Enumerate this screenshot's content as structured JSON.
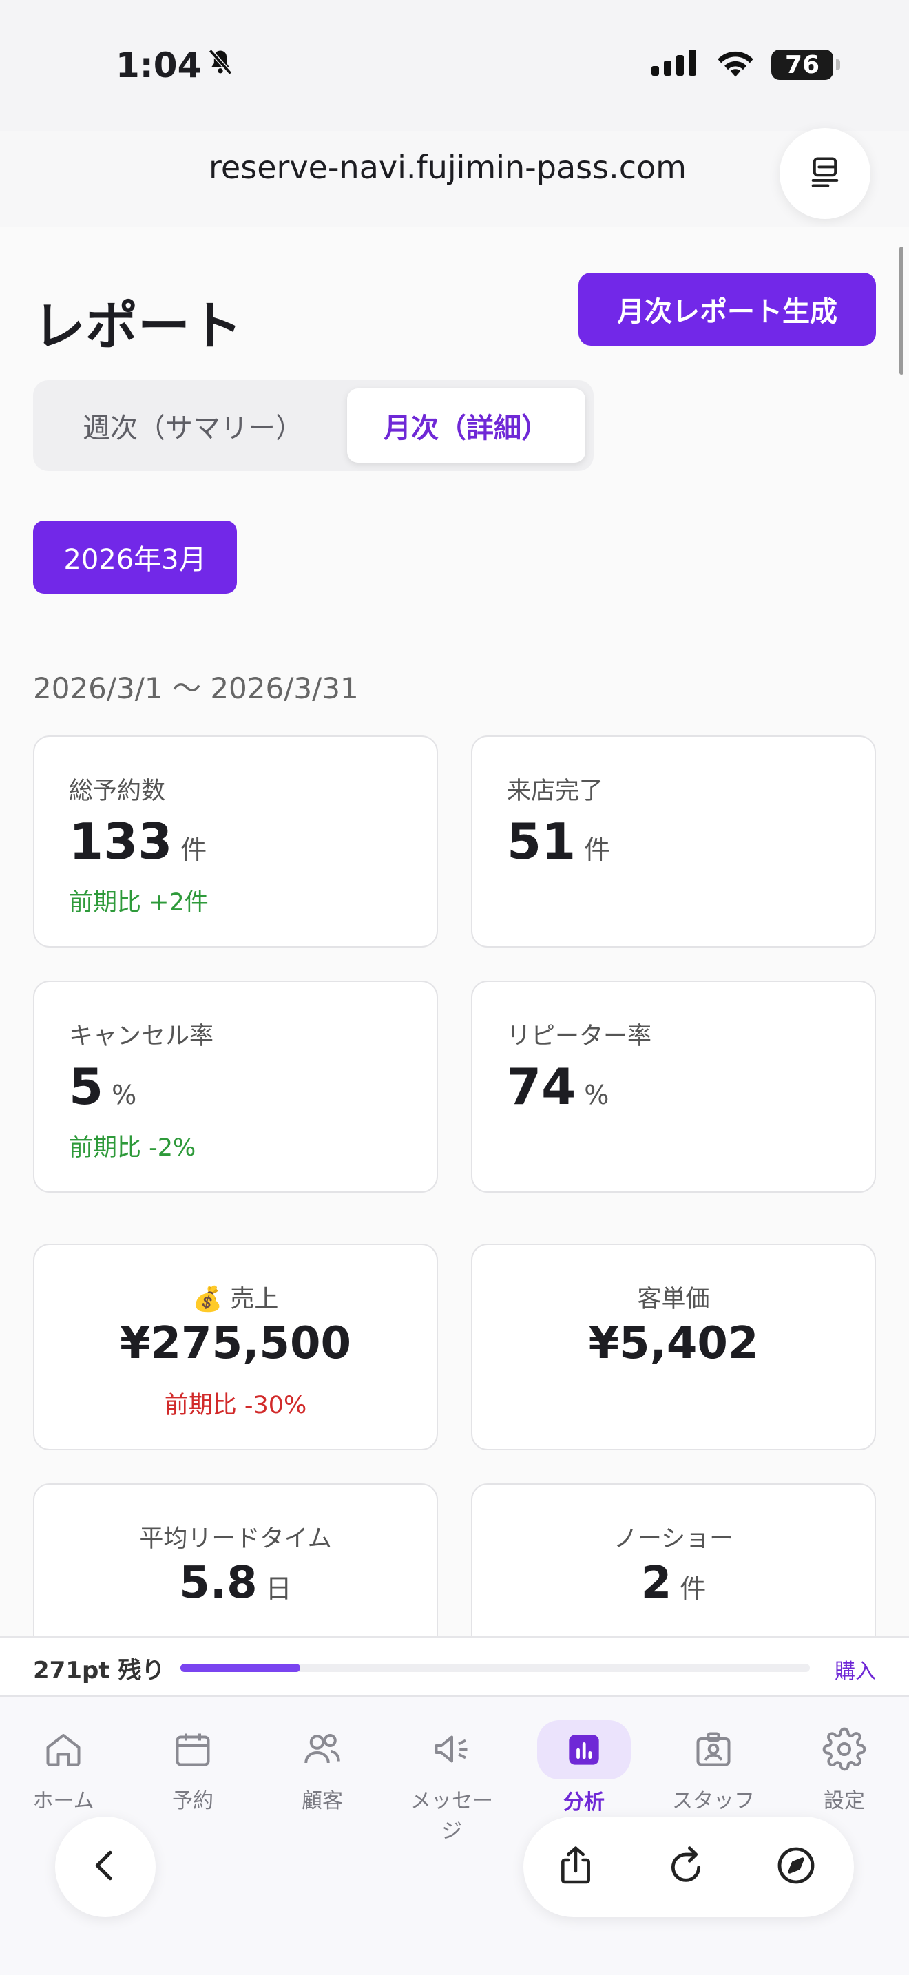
{
  "status": {
    "time": "1:04",
    "battery": "76"
  },
  "browser": {
    "url": "reserve-navi.fujimin-pass.com"
  },
  "page": {
    "title": "レポート",
    "generate_button": "月次レポート生成"
  },
  "segment": {
    "weekly": "週次（サマリー）",
    "monthly": "月次（詳細）",
    "selected": "月次（詳細）"
  },
  "period": {
    "month": "2026年3月",
    "range": "2026/3/1 〜 2026/3/31"
  },
  "stats": {
    "total_reservations": {
      "label": "総予約数",
      "value": "133",
      "unit": "件",
      "delta": "前期比 +2件"
    },
    "visits_completed": {
      "label": "来店完了",
      "value": "51",
      "unit": "件"
    },
    "cancel_rate": {
      "label": "キャンセル率",
      "value": "5",
      "unit": "%",
      "delta": "前期比 -2%"
    },
    "repeater_rate": {
      "label": "リピーター率",
      "value": "74",
      "unit": "%"
    },
    "sales": {
      "icon": "money-bag-icon",
      "label": "売上",
      "value": "¥275,500",
      "delta": "前期比 -30%"
    },
    "avg_spend": {
      "label": "客単価",
      "value": "¥5,402"
    },
    "lead_time": {
      "label": "平均リードタイム",
      "value": "5.8",
      "unit": "日"
    },
    "no_show": {
      "label": "ノーショー",
      "value": "2",
      "unit": "件"
    }
  },
  "points": {
    "remaining": "271pt 残り",
    "progress": 0.19,
    "buy_label": "購入"
  },
  "tabs": [
    {
      "label": "ホーム",
      "icon": "home-icon"
    },
    {
      "label": "予約",
      "icon": "calendar-icon"
    },
    {
      "label": "顧客",
      "icon": "users-icon"
    },
    {
      "label": "メッセージ",
      "icon": "megaphone-icon"
    },
    {
      "label": "分析",
      "icon": "chart-icon",
      "active": true
    },
    {
      "label": "スタッフ",
      "icon": "badge-icon"
    },
    {
      "label": "設定",
      "icon": "gear-icon"
    }
  ],
  "colors": {
    "accent": "#7228e8",
    "positive": "#2e9a3a",
    "negative": "#d12a2a"
  }
}
